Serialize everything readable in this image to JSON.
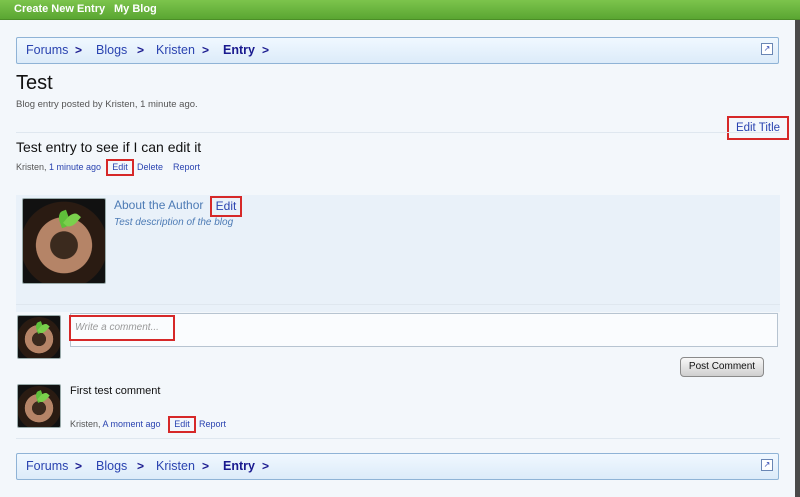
{
  "topnav": {
    "create_new_entry": "Create New Entry",
    "my_blog": "My Blog"
  },
  "breadcrumb": {
    "items": [
      "Forums",
      "Blogs",
      "Kristen",
      "Entry"
    ],
    "separator": ">"
  },
  "post": {
    "title": "Test",
    "byline": "Blog entry posted by Kristen, 1 minute ago.",
    "edit_title": "Edit Title",
    "entry_text": "Test entry to see if I can edit it",
    "meta": {
      "author": "Kristen,",
      "time": "1 minute ago",
      "edit": "Edit",
      "delete": "Delete",
      "report": "Report"
    }
  },
  "author_box": {
    "title": "About the Author",
    "edit": "Edit",
    "description": "Test description of the blog"
  },
  "comment_form": {
    "placeholder": "Write a comment...",
    "post_button": "Post Comment"
  },
  "comments": [
    {
      "text": "First test comment",
      "author": "Kristen,",
      "time": "A moment ago",
      "edit": "Edit",
      "report": "Report"
    }
  ],
  "colors": {
    "topbar": "#6bb63f",
    "link": "#2a43b0",
    "highlight": "#d62828",
    "panel": "#e9f1f9"
  },
  "icons": {
    "popout": "popout-icon",
    "avatar": "avatar-plant-image"
  }
}
